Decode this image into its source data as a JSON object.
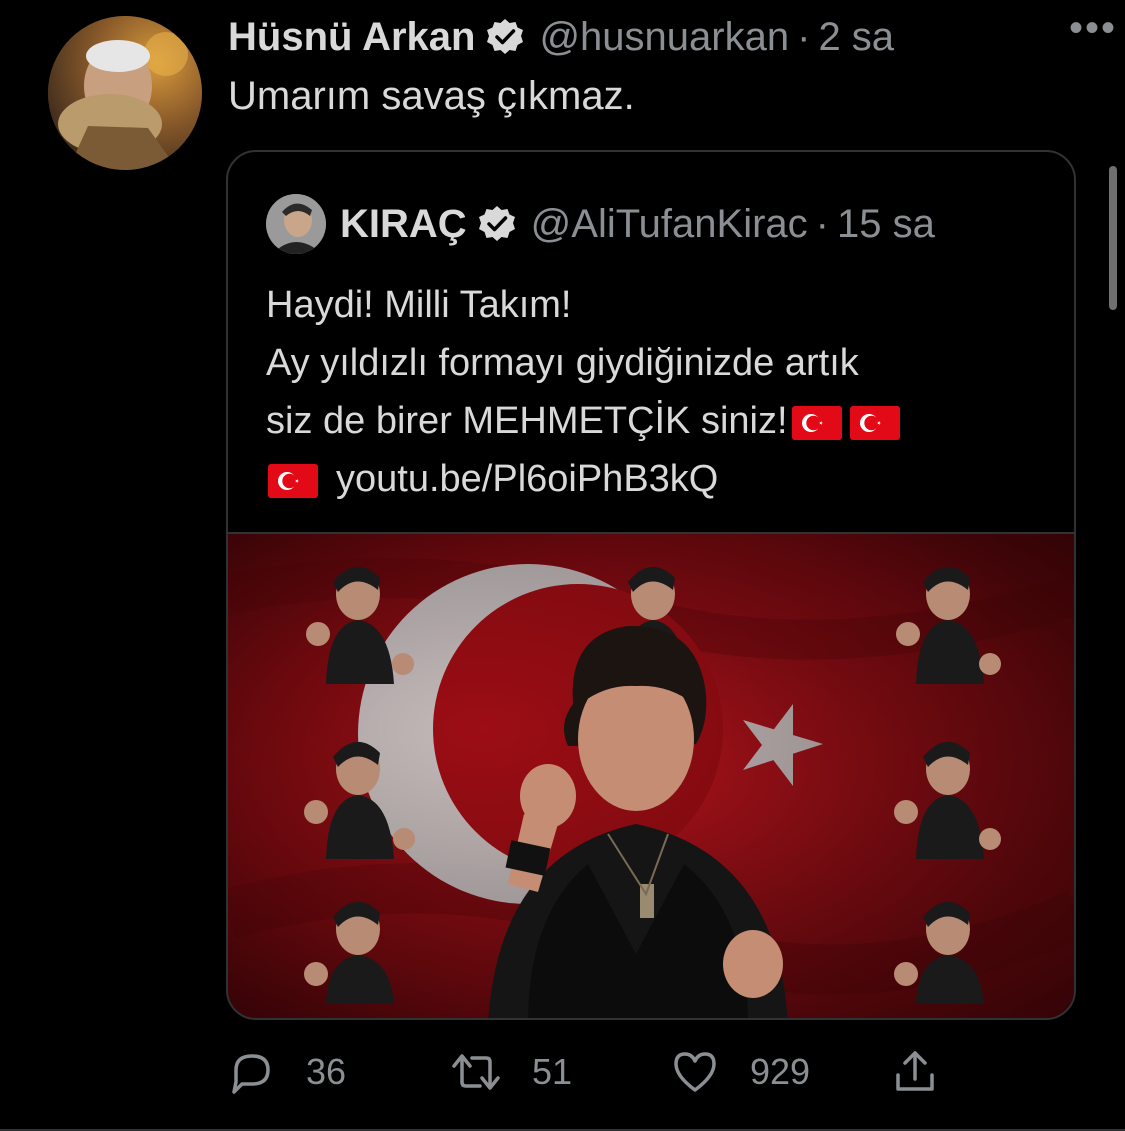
{
  "tweet": {
    "author_name": "Hüsnü Arkan",
    "handle": "@husnuarkan",
    "separator": "·",
    "time": "2 sa",
    "more_label": "•••",
    "text": "Umarım savaş çıkmaz.",
    "verified_icon": "verified-badge-icon"
  },
  "quoted": {
    "author_name": "KIRAÇ",
    "handle": "@AliTufanKirac",
    "separator": "·",
    "time": "15 sa",
    "lines": [
      "Haydi! Milli Takım!",
      "Ay yıldızlı formayı giydiğinizde artık",
      "siz de birer MEHMETÇİK siniz!",
      "youtu.be/Pl6oiPhB3kQ"
    ],
    "emoji": "🇹🇷"
  },
  "actions": {
    "reply_count": "36",
    "retweet_count": "51",
    "like_count": "929"
  },
  "colors": {
    "background": "#000000",
    "text": "#d9d9d9",
    "secondary": "#8b8f94",
    "border": "#2f3336",
    "flag_red": "#e30a17"
  }
}
